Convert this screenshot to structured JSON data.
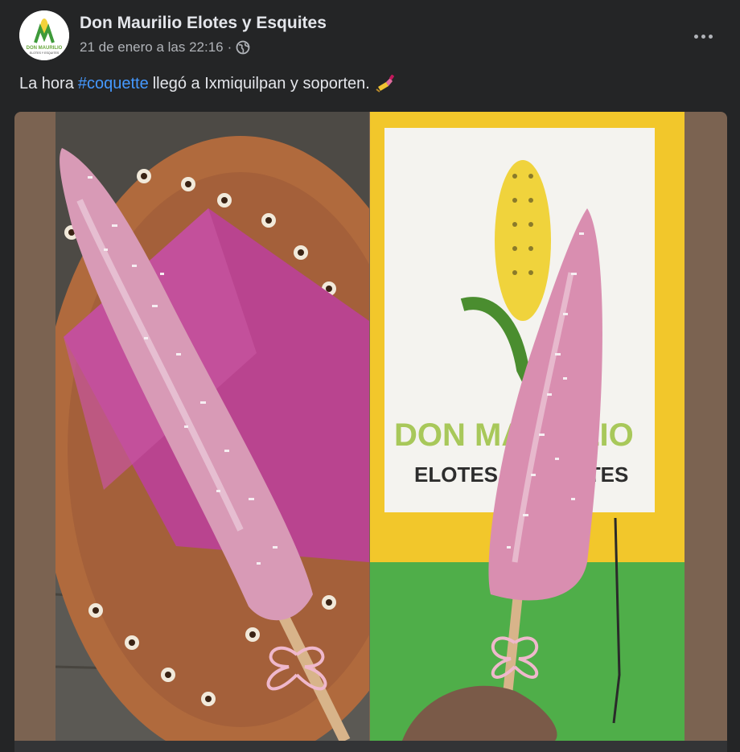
{
  "post": {
    "page_name": "Don Maurilio Elotes y Esquites",
    "timestamp": "21 de enero a las 22:16",
    "separator": "·",
    "audience_icon": "globe-icon",
    "more_icon": "more-options-icon",
    "caption_before": "La hora",
    "hashtag": "#coquette",
    "caption_after": "llegó a Ixmiquilpan y soporten.",
    "caption_emoji": "nail-polish-emoji"
  },
  "avatar": {
    "logo_line1": "DON MAURILIO",
    "logo_line2": "ELOTES Y ESQUITES"
  },
  "photo_right": {
    "sign_line1": "DON MAURILIO",
    "sign_line2": "ELOTES Y ESQUITES"
  },
  "colors": {
    "background": "#242526",
    "text_primary": "#e4e6eb",
    "text_secondary": "#b0b3b8",
    "hashtag": "#4599ff",
    "media_frame": "#7b6351"
  }
}
